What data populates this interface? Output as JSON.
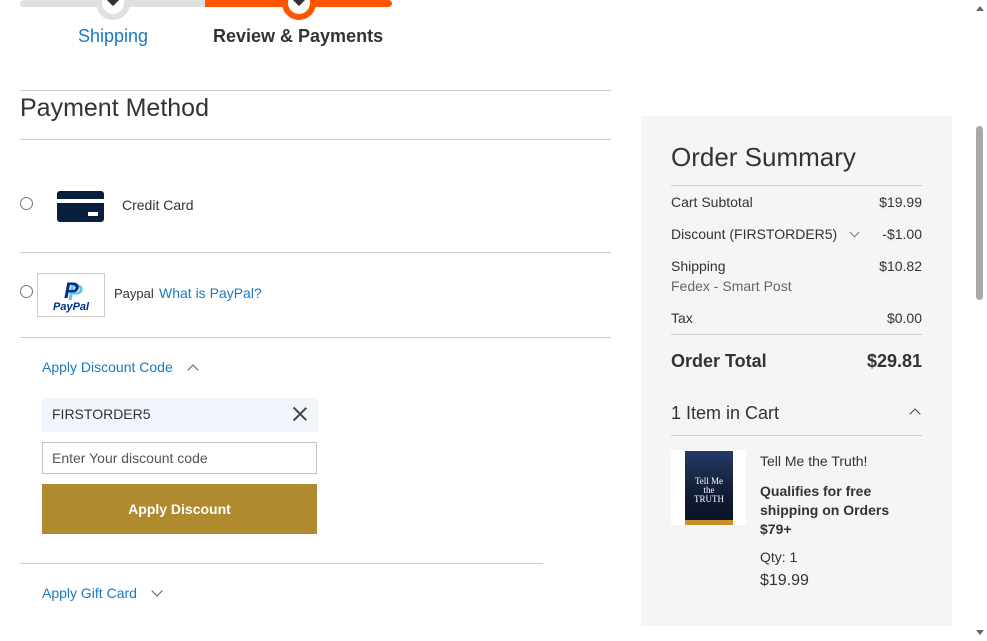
{
  "steps": {
    "shipping_label": "Shipping",
    "review_label": "Review & Payments"
  },
  "payment": {
    "title": "Payment Method",
    "credit_card_label": "Credit Card",
    "paypal_label": "Paypal",
    "paypal_link": "What is PayPal?",
    "paypal_logo_text": "PayPal"
  },
  "discount": {
    "toggle_label": "Apply Discount Code",
    "applied_code": "FIRSTORDER5",
    "input_placeholder": "Enter Your discount code",
    "apply_button": "Apply Discount"
  },
  "gift": {
    "toggle_label": "Apply Gift Card"
  },
  "summary": {
    "title": "Order Summary",
    "cart_subtotal_label": "Cart Subtotal",
    "cart_subtotal_value": "$19.99",
    "discount_label": "Discount (FIRSTORDER5)",
    "discount_value": "-$1.00",
    "shipping_label": "Shipping",
    "shipping_method": "Fedex - Smart Post",
    "shipping_value": "$10.82",
    "tax_label": "Tax",
    "tax_value": "$0.00",
    "order_total_label": "Order Total",
    "order_total_value": "$29.81",
    "items_in_cart_label": "1 Item in Cart"
  },
  "cart_item": {
    "name": "Tell Me the Truth!",
    "shipping_note": "Qualifies for free shipping on Orders $79+",
    "qty_label": "Qty: 1",
    "price": "$19.99",
    "cover_text": "Tell Me the TRUTH"
  },
  "colors": {
    "accent_orange": "#ff5501",
    "link_blue": "#1979c3",
    "apply_button_gold": "#b08a2e",
    "summary_bg": "#f5f5f5"
  }
}
